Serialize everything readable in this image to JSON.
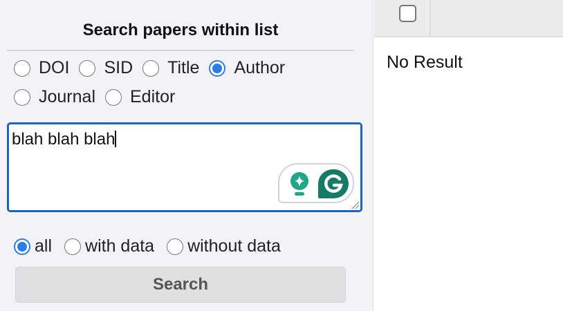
{
  "search_panel": {
    "title": "Search papers within list",
    "fields": [
      {
        "label": "DOI",
        "selected": false
      },
      {
        "label": "SID",
        "selected": false
      },
      {
        "label": "Title",
        "selected": false
      },
      {
        "label": "Author",
        "selected": true
      },
      {
        "label": "Journal",
        "selected": false
      },
      {
        "label": "Editor",
        "selected": false
      }
    ],
    "query": "blah blah blah",
    "filters": [
      {
        "label": "all",
        "selected": true
      },
      {
        "label": "with data",
        "selected": false
      },
      {
        "label": "without data",
        "selected": false
      }
    ],
    "search_label": "Search"
  },
  "results": {
    "empty_text": "No Result",
    "select_all_checked": false
  },
  "colors": {
    "accent": "#2b7de9",
    "focus_border": "#1d62c8",
    "grammarly": "#157a66"
  }
}
